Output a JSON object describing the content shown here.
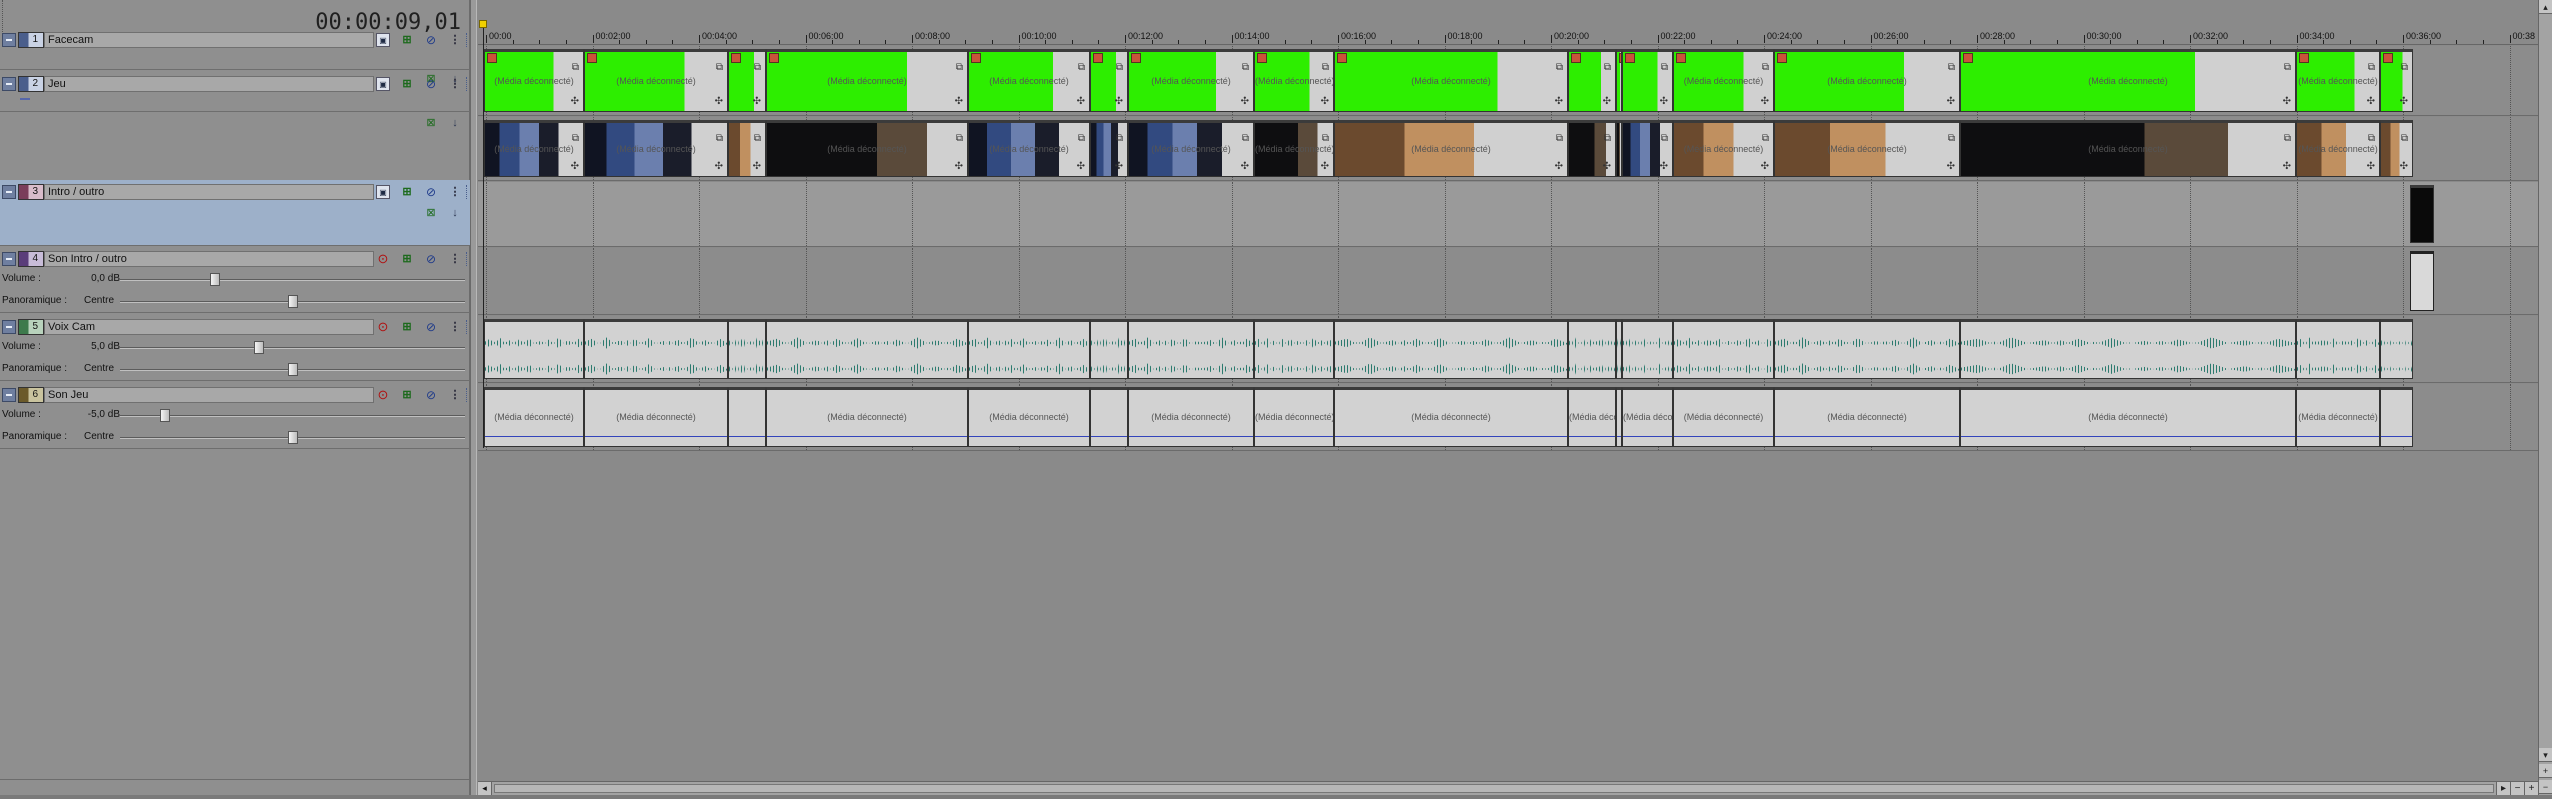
{
  "timecode": "00:00:09,01",
  "ruler_labels": [
    "00:00",
    "00:02:00",
    "00:04:00",
    "00:06:00",
    "00:08:00",
    "00:10:00",
    "00:12:00",
    "00:14:00",
    "00:16:00",
    "00:18:00",
    "00:20:00",
    "00:22:00",
    "00:24:00",
    "00:26:00",
    "00:28:00",
    "00:30:00",
    "00:32:00",
    "00:34:00",
    "00:36:00",
    "00:38"
  ],
  "tracks": [
    {
      "number": "1",
      "name": "Facecam",
      "kind": "video"
    },
    {
      "number": "2",
      "name": "Jeu",
      "kind": "video"
    },
    {
      "number": "3",
      "name": "Intro / outro",
      "kind": "video"
    },
    {
      "number": "4",
      "name": "Son Intro / outro",
      "kind": "audio",
      "volume_label": "Volume :",
      "volume_value": "0,0 dB",
      "volume_level": 0.27,
      "pan_label": "Panoramique :",
      "pan_value": "Centre",
      "pan_level": 0.5
    },
    {
      "number": "5",
      "name": "Voix Cam",
      "kind": "audio",
      "volume_label": "Volume :",
      "volume_value": "5,0 dB",
      "volume_level": 0.4,
      "pan_label": "Panoramique :",
      "pan_value": "Centre",
      "pan_level": 0.5
    },
    {
      "number": "6",
      "name": "Son Jeu",
      "kind": "audio",
      "volume_label": "Volume :",
      "volume_value": "-5,0 dB",
      "volume_level": 0.12,
      "pan_label": "Panoramique :",
      "pan_value": "Centre",
      "pan_level": 0.5
    }
  ],
  "clip_label": "(Média déconnecté)",
  "icons": {
    "collapse": "minus-icon",
    "track_motion": "track-motion-icon",
    "fx": "fx-icon",
    "mute": "mute-icon",
    "solo": "solo-icon",
    "more": "more-icon",
    "arm": "record-arm-icon",
    "compositing": "compositing-icon",
    "crop": "crop-icon",
    "pan": "pan-crop-icon"
  },
  "colors": {
    "greenscreen": "#2dee00",
    "waveform": "#2b7a6e",
    "envelope": "#3344bb",
    "selected_track": "#9db0c9",
    "playhead": "#f0d000"
  }
}
